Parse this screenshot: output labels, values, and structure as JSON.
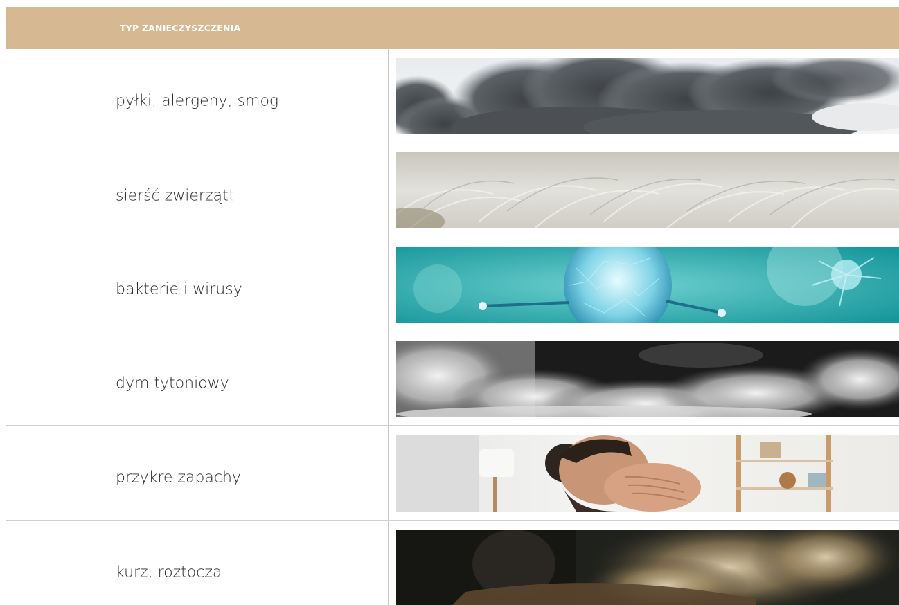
{
  "table": {
    "header": "TYP ZANIECZYSZCZENIA",
    "rows": [
      {
        "label": "pyłki, alergeny, smog",
        "image": "smog-cloud-photo"
      },
      {
        "label": "sierść zwierząt",
        "label_trailing": "t",
        "image": "animal-fur-photo"
      },
      {
        "label": "bakterie i wirusy",
        "image": "virus-particle-photo"
      },
      {
        "label": "dym tytoniowy",
        "image": "tobacco-smoke-photo"
      },
      {
        "label": "przykre zapachy",
        "image": "man-covering-nose-photo"
      },
      {
        "label": "kurz, roztocza",
        "image": "dust-cloud-photo"
      }
    ]
  },
  "colors": {
    "header_bg": "#d6b893",
    "header_text": "#ffffff",
    "text": "#2c2c2c",
    "divider": "#cfcfcf"
  }
}
